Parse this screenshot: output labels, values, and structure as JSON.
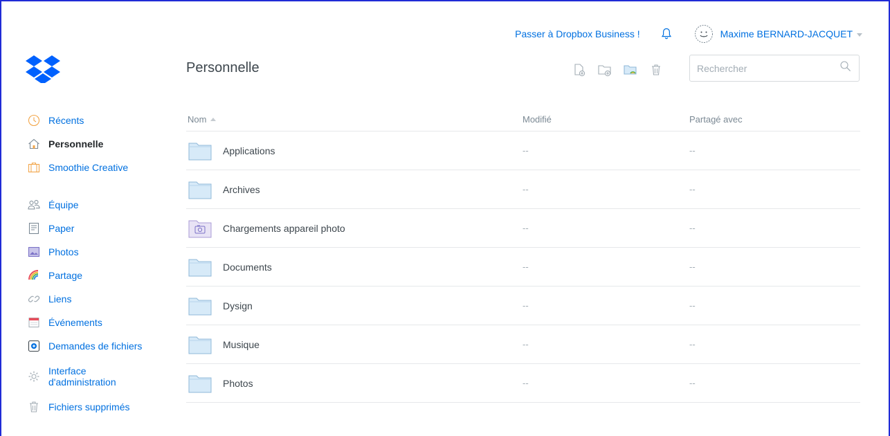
{
  "header": {
    "upgrade_label": "Passer à Dropbox Business !",
    "user_name": "Maxime BERNARD-JACQUET"
  },
  "page": {
    "title": "Personnelle"
  },
  "search": {
    "placeholder": "Rechercher"
  },
  "sidebar": {
    "items": [
      {
        "label": "Récents",
        "icon": "clock-icon"
      },
      {
        "label": "Personnelle",
        "icon": "home-icon",
        "active": true
      },
      {
        "label": "Smoothie Creative",
        "icon": "briefcase-icon"
      },
      {
        "label": "Équipe",
        "icon": "team-icon"
      },
      {
        "label": "Paper",
        "icon": "paper-icon"
      },
      {
        "label": "Photos",
        "icon": "photos-icon"
      },
      {
        "label": "Partage",
        "icon": "rainbow-icon"
      },
      {
        "label": "Liens",
        "icon": "link-icon"
      },
      {
        "label": "Événements",
        "icon": "calendar-icon"
      },
      {
        "label": "Demandes de fichiers",
        "icon": "file-request-icon"
      },
      {
        "label_line1": "Interface",
        "label_line2": "d'administration",
        "icon": "gear-icon"
      },
      {
        "label": "Fichiers supprimés",
        "icon": "trash-icon"
      }
    ]
  },
  "table": {
    "columns": {
      "name": "Nom",
      "modified": "Modifié",
      "shared": "Partagé avec"
    },
    "rows": [
      {
        "name": "Applications",
        "modified": "--",
        "shared": "--",
        "type": "folder"
      },
      {
        "name": "Archives",
        "modified": "--",
        "shared": "--",
        "type": "folder"
      },
      {
        "name": "Chargements appareil photo",
        "modified": "--",
        "shared": "--",
        "type": "camera-folder"
      },
      {
        "name": "Documents",
        "modified": "--",
        "shared": "--",
        "type": "folder"
      },
      {
        "name": "Dysign",
        "modified": "--",
        "shared": "--",
        "type": "folder"
      },
      {
        "name": "Musique",
        "modified": "--",
        "shared": "--",
        "type": "folder"
      },
      {
        "name": "Photos",
        "modified": "--",
        "shared": "--",
        "type": "folder"
      }
    ]
  },
  "colors": {
    "link": "#0070e0",
    "folder_fill": "#d7eaf8",
    "folder_stroke": "#8fb8d8",
    "logo": "#0061fe"
  }
}
